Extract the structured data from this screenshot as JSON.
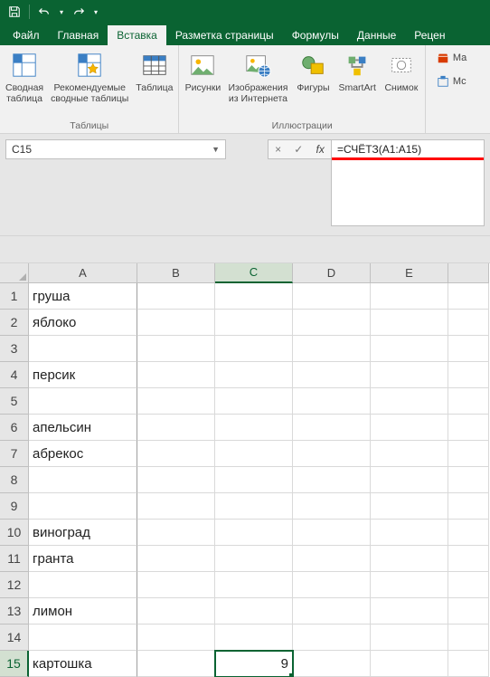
{
  "qat": {
    "save": "save-icon",
    "undo": "undo-icon",
    "redo": "redo-icon"
  },
  "tabs": [
    "Файл",
    "Главная",
    "Вставка",
    "Разметка страницы",
    "Формулы",
    "Данные",
    "Рецен"
  ],
  "active_tab_index": 2,
  "ribbon": {
    "group1": {
      "label": "Таблицы",
      "pivot": "Сводная\nтаблица",
      "recpivot": "Рекомендуемые\nсводные таблицы",
      "table": "Таблица"
    },
    "group2": {
      "label": "Иллюстрации",
      "pictures": "Рисунки",
      "online": "Изображения\nиз Интернета",
      "shapes": "Фигуры",
      "smartart": "SmartArt",
      "screenshot": "Снимок"
    },
    "right": {
      "store": "Ма",
      "my": "Мс"
    }
  },
  "namebox": "C15",
  "formula": "=СЧЁТЗ(A1:A15)",
  "cancel_glyph": "×",
  "accept_glyph": "✓",
  "fx_glyph": "fx",
  "columns": [
    "A",
    "B",
    "C",
    "D",
    "E",
    ""
  ],
  "rows": [
    {
      "n": "1",
      "A": "груша"
    },
    {
      "n": "2",
      "A": "яблоко"
    },
    {
      "n": "3",
      "A": ""
    },
    {
      "n": "4",
      "A": "персик"
    },
    {
      "n": "5",
      "A": ""
    },
    {
      "n": "6",
      "A": "апельсин"
    },
    {
      "n": "7",
      "A": "абрекос"
    },
    {
      "n": "8",
      "A": ""
    },
    {
      "n": "9",
      "A": ""
    },
    {
      "n": "10",
      "A": "виноград"
    },
    {
      "n": "11",
      "A": "гранта"
    },
    {
      "n": "12",
      "A": ""
    },
    {
      "n": "13",
      "A": "лимон"
    },
    {
      "n": "14",
      "A": ""
    },
    {
      "n": "15",
      "A": "картошка",
      "C": "9"
    }
  ],
  "active_cell": {
    "row": 15,
    "col": "C"
  }
}
